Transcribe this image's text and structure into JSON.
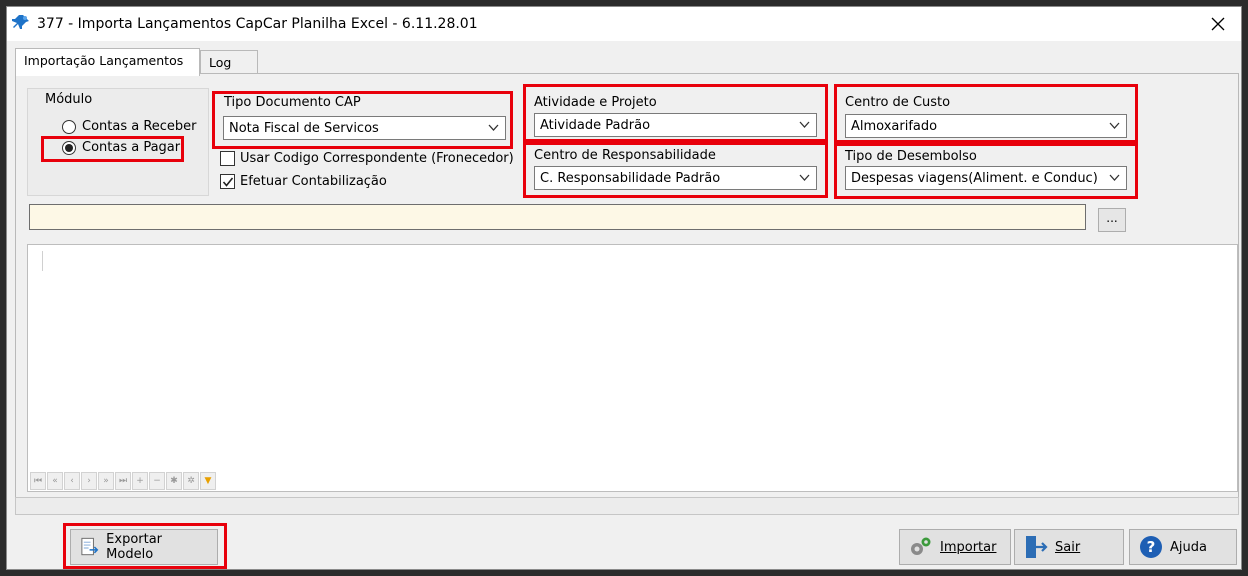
{
  "window": {
    "title": "377 - Importa Lançamentos CapCar Planilha Excel - 6.11.28.01",
    "close_label": "✕"
  },
  "tabs": [
    {
      "label": "Importação Lançamentos",
      "active": true
    },
    {
      "label": "Log",
      "active": false
    }
  ],
  "modulo": {
    "legend": "Módulo",
    "options": [
      {
        "label": "Contas a Receber",
        "selected": false
      },
      {
        "label": "Contas a Pagar",
        "selected": true
      }
    ]
  },
  "tipo_documento": {
    "label": "Tipo Documento CAP",
    "value": "Nota Fiscal de Servicos"
  },
  "checkboxes": [
    {
      "label": "Usar Codigo Correspondente (Fronecedor)",
      "checked": false
    },
    {
      "label": "Efetuar Contabilização",
      "checked": true
    }
  ],
  "atividade": {
    "label": "Atividade e Projeto",
    "value": "Atividade Padrão"
  },
  "centro_responsabilidade": {
    "label": "Centro de Responsabilidade",
    "value": "C. Responsabilidade Padrão"
  },
  "centro_custo": {
    "label": "Centro de Custo",
    "value": "Almoxarifado"
  },
  "tipo_desembolso": {
    "label": "Tipo de Desembolso",
    "value": "Despesas viagens(Aliment. e Conduc)"
  },
  "file": {
    "value": "",
    "browse_label": "..."
  },
  "navigator": [
    "⏮",
    "«",
    "‹",
    "›",
    "»",
    "⏭",
    "+",
    "−",
    "✱",
    "✲",
    "▼"
  ],
  "footer": {
    "exportar_label": "Exportar Modelo",
    "importar_label": "Importar",
    "sair_label": "Sair",
    "ajuda_label": "Ajuda"
  },
  "colors": {
    "highlight": "#e8000b",
    "input_bg": "#fdf8e6"
  }
}
